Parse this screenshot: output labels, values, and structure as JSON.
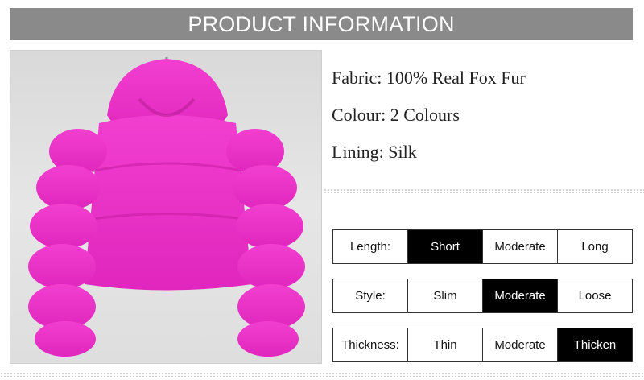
{
  "header": {
    "title": "PRODUCT INFORMATION"
  },
  "colors": {
    "header_bg": "#8a8a8a",
    "fur_pink": "#ee2fc8",
    "selected_bg": "#000000"
  },
  "specs": [
    {
      "label": "Fabric:",
      "value": "100% Real Fox Fur"
    },
    {
      "label": "Colour:",
      "value": "2 Colours"
    },
    {
      "label": "Lining:",
      "value": "Silk"
    }
  ],
  "attributes": [
    {
      "label": "Length:",
      "options": [
        "Short",
        "Moderate",
        "Long"
      ],
      "selected": "Short"
    },
    {
      "label": "Style:",
      "options": [
        "Slim",
        "Moderate",
        "Loose"
      ],
      "selected": "Moderate"
    },
    {
      "label": "Thickness:",
      "options": [
        "Thin",
        "Moderate",
        "Thicken"
      ],
      "selected": "Thicken"
    }
  ]
}
